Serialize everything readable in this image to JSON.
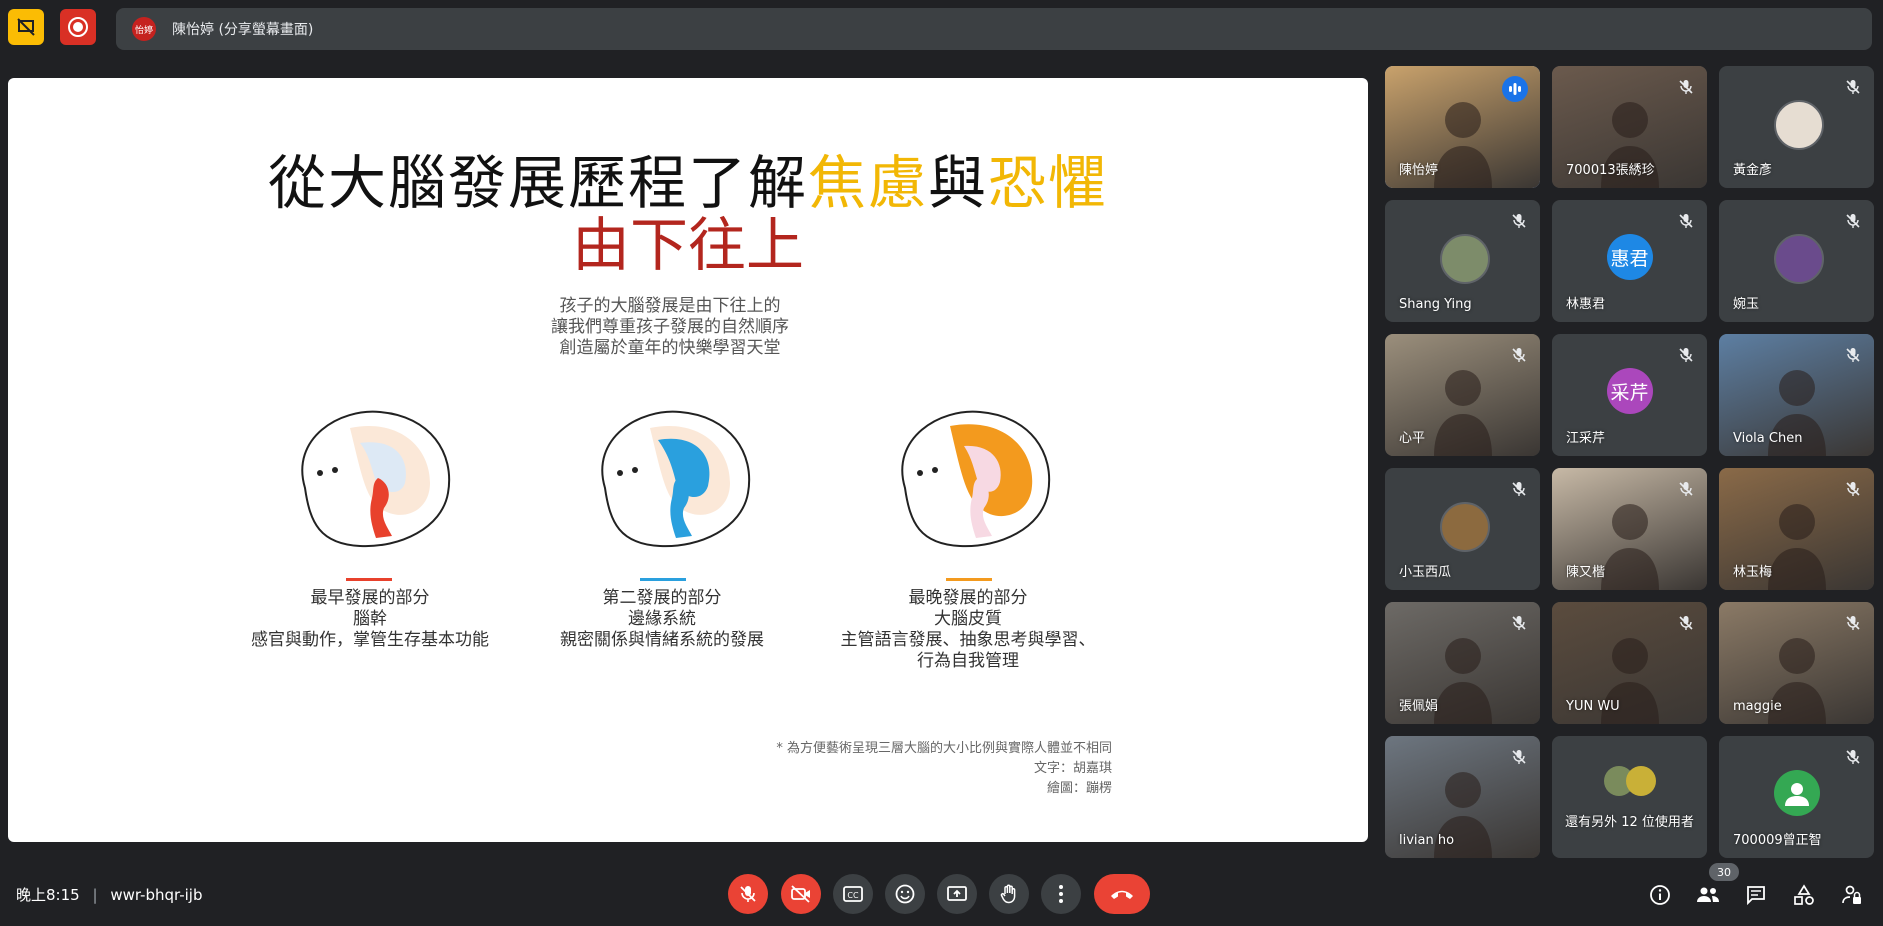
{
  "topbar": {
    "presenter_avatar": "怡婷",
    "presenter_label": "陳怡婷 (分享螢幕畫面)"
  },
  "slide": {
    "title_part1": "從大腦發展歷程了解",
    "title_gold1": "焦慮",
    "title_mid": "與",
    "title_gold2": "恐懼",
    "subtitle": "由下往上",
    "intro": [
      "孩子的大腦發展是由下往上的",
      "讓我們尊重孩子發展的自然順序",
      "創造屬於童年的快樂學習天堂"
    ],
    "stages": [
      {
        "line1": "最早發展的部分",
        "line2": "腦幹",
        "line3": "感官與動作，掌管生存基本功能",
        "line4": "",
        "color": "#e8412c"
      },
      {
        "line1": "第二發展的部分",
        "line2": "邊緣系統",
        "line3": "親密關係與情緒系統的發展",
        "line4": "",
        "color": "#2aa0de"
      },
      {
        "line1": "最晚發展的部分",
        "line2": "大腦皮質",
        "line3": "主管語言發展、抽象思考與學習、",
        "line4": "行為自我管理",
        "color": "#f39a1e"
      }
    ],
    "note": [
      "* 為方便藝術呈現三層大腦的大小比例與實際人體並不相同",
      "文字：胡嘉琪",
      "繪圖：蹦楞"
    ]
  },
  "participants": [
    {
      "name": "陳怡婷",
      "kind": "video",
      "bg": "#c9a26c",
      "speaking": true
    },
    {
      "name": "700013張綉珍",
      "kind": "video",
      "bg": "#6b5a4d"
    },
    {
      "name": "黃金彥",
      "kind": "photo",
      "bg": "#e6ddd2"
    },
    {
      "name": "Shang Ying",
      "kind": "photo",
      "bg": "#7d8c6a"
    },
    {
      "name": "林惠君",
      "kind": "letter",
      "letter": "惠君",
      "bg": "#1e88e5"
    },
    {
      "name": "婉玉",
      "kind": "photo",
      "bg": "#6a4b8c"
    },
    {
      "name": "心平",
      "kind": "video",
      "bg": "#9b8f7c"
    },
    {
      "name": "江采芹",
      "kind": "letter",
      "letter": "采芹",
      "bg": "#ab47bc"
    },
    {
      "name": "Viola Chen",
      "kind": "video",
      "bg": "#5d7fa3"
    },
    {
      "name": "小玉西瓜",
      "kind": "photo",
      "bg": "#8c6a3f"
    },
    {
      "name": "陳又楷",
      "kind": "video",
      "bg": "#c7b9a6"
    },
    {
      "name": "林玉梅",
      "kind": "video",
      "bg": "#8a6a48"
    },
    {
      "name": "張佩娟",
      "kind": "video",
      "bg": "#6d6a66"
    },
    {
      "name": "YUN WU",
      "kind": "video",
      "bg": "#5b4c3e"
    },
    {
      "name": "maggie",
      "kind": "video",
      "bg": "#8b7a66"
    },
    {
      "name": "livian ho",
      "kind": "video",
      "bg": "#6d7680"
    },
    {
      "name": "還有另外 12 位使用者",
      "kind": "more",
      "bg": "#3c4043"
    },
    {
      "name": "700009曾正智",
      "kind": "letter",
      "letter": "",
      "bg": "#34a853"
    }
  ],
  "bottombar": {
    "time": "晚上8:15",
    "meeting_code": "wwr-bhqr-ijb",
    "people_count": "30"
  },
  "colors": {
    "background": "#202124",
    "accent": "#8ab4f8",
    "danger": "#ea4335",
    "gold": "#f2b705",
    "red_title": "#b3261e"
  }
}
